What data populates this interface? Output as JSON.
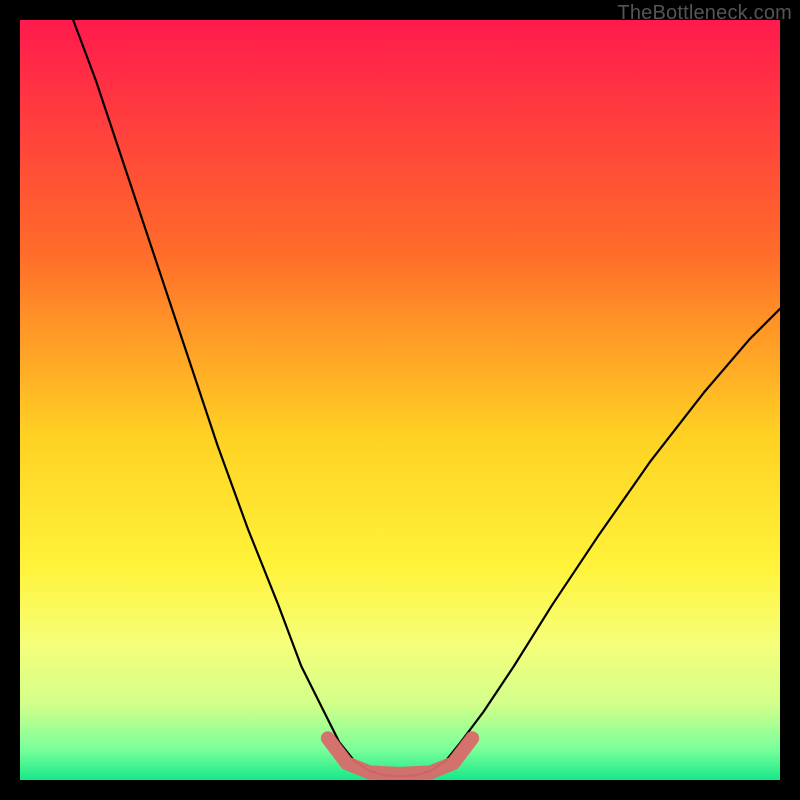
{
  "watermark": "TheBottleneck.com",
  "chart_data": {
    "type": "line",
    "title": "",
    "xlabel": "",
    "ylabel": "",
    "x_range": [
      0,
      100
    ],
    "y_range": [
      0,
      100
    ],
    "grid": false,
    "legend": false,
    "background_gradient": {
      "stops": [
        {
          "offset": 0.0,
          "color": "#ff1a4d"
        },
        {
          "offset": 0.3,
          "color": "#ff6a2a"
        },
        {
          "offset": 0.55,
          "color": "#ffd223"
        },
        {
          "offset": 0.72,
          "color": "#fff33a"
        },
        {
          "offset": 0.82,
          "color": "#f6ff7a"
        },
        {
          "offset": 0.9,
          "color": "#d2ff8a"
        },
        {
          "offset": 0.96,
          "color": "#79ff9a"
        },
        {
          "offset": 1.0,
          "color": "#17e88a"
        }
      ]
    },
    "series": [
      {
        "name": "curve",
        "stroke": "#000000",
        "stroke_width": 2.2,
        "points": [
          {
            "x": 7,
            "y": 100
          },
          {
            "x": 10,
            "y": 92
          },
          {
            "x": 14,
            "y": 80
          },
          {
            "x": 18,
            "y": 68
          },
          {
            "x": 22,
            "y": 56
          },
          {
            "x": 26,
            "y": 44
          },
          {
            "x": 30,
            "y": 33
          },
          {
            "x": 34,
            "y": 23
          },
          {
            "x": 37,
            "y": 15
          },
          {
            "x": 40,
            "y": 9
          },
          {
            "x": 42,
            "y": 5
          },
          {
            "x": 44,
            "y": 2.5
          },
          {
            "x": 46,
            "y": 1.2
          },
          {
            "x": 48,
            "y": 0.6
          },
          {
            "x": 50,
            "y": 0.5
          },
          {
            "x": 52,
            "y": 0.6
          },
          {
            "x": 54,
            "y": 1.2
          },
          {
            "x": 56,
            "y": 2.5
          },
          {
            "x": 58,
            "y": 5
          },
          {
            "x": 61,
            "y": 9
          },
          {
            "x": 65,
            "y": 15
          },
          {
            "x": 70,
            "y": 23
          },
          {
            "x": 76,
            "y": 32
          },
          {
            "x": 83,
            "y": 42
          },
          {
            "x": 90,
            "y": 51
          },
          {
            "x": 96,
            "y": 58
          },
          {
            "x": 100,
            "y": 62
          }
        ]
      },
      {
        "name": "min-highlight",
        "stroke": "#d96a6a",
        "stroke_width": 14,
        "linecap": "round",
        "points": [
          {
            "x": 40.5,
            "y": 5.5
          },
          {
            "x": 43,
            "y": 2.2
          },
          {
            "x": 46,
            "y": 1.0
          },
          {
            "x": 50,
            "y": 0.8
          },
          {
            "x": 54,
            "y": 1.0
          },
          {
            "x": 57,
            "y": 2.2
          },
          {
            "x": 59.5,
            "y": 5.5
          }
        ]
      }
    ]
  }
}
